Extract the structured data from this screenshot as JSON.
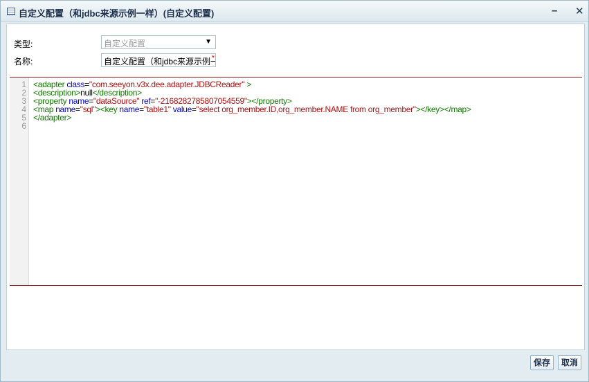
{
  "window": {
    "title": "自定义配置（和jdbc来源示例一样）(自定义配置)",
    "minimize": "–",
    "close": "✕"
  },
  "form": {
    "type_label": "类型:",
    "type_value": "自定义配置",
    "name_label": "名称:",
    "name_value": "自定义配置（和jdbc来源示例一样）",
    "required_mark": "*"
  },
  "editor": {
    "line_numbers": [
      "1",
      "2",
      "3",
      "4",
      "5",
      "6"
    ],
    "lines": [
      [
        [
          "t",
          "<adapter "
        ],
        [
          "a",
          "class"
        ],
        [
          "x",
          "="
        ],
        [
          "v",
          "\"com.seeyon.v3x.dee.adapter.JDBCReader\""
        ],
        [
          "t",
          " >"
        ]
      ],
      [
        [
          "t",
          "<description>"
        ],
        [
          "x",
          "null"
        ],
        [
          "t",
          "</description>"
        ]
      ],
      [
        [
          "t",
          "<property "
        ],
        [
          "a",
          "name"
        ],
        [
          "x",
          "="
        ],
        [
          "v",
          "\"dataSource\""
        ],
        [
          "a",
          " ref"
        ],
        [
          "x",
          "="
        ],
        [
          "v",
          "\"-2168282785807054559\""
        ],
        [
          "t",
          "></property>"
        ]
      ],
      [
        [
          "t",
          "<map "
        ],
        [
          "a",
          "name"
        ],
        [
          "x",
          "="
        ],
        [
          "v",
          "\"sql\""
        ],
        [
          "t",
          "><key "
        ],
        [
          "a",
          "name"
        ],
        [
          "x",
          "="
        ],
        [
          "v",
          "\"table1\""
        ],
        [
          "a",
          " value"
        ],
        [
          "x",
          "="
        ],
        [
          "v",
          "\"select org_member.ID,org_member.NAME from org_member\""
        ],
        [
          "t",
          "></key></map>"
        ]
      ],
      [
        [
          "t",
          "</adapter>"
        ]
      ],
      []
    ]
  },
  "footer": {
    "save": "保存",
    "cancel": "取消"
  }
}
